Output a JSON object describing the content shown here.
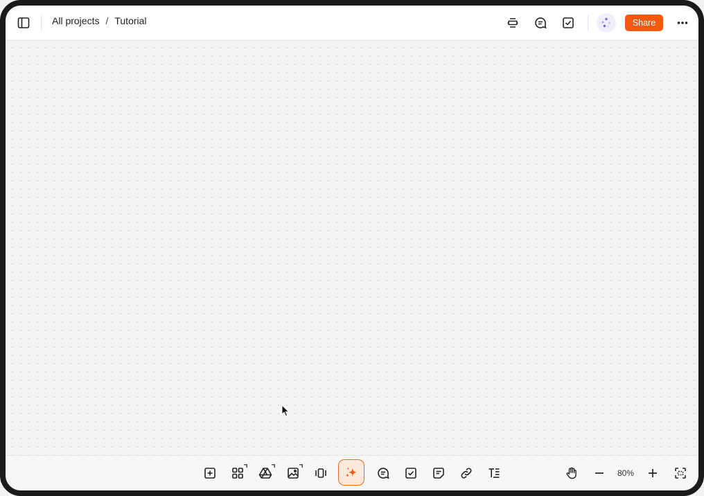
{
  "header": {
    "breadcrumb": {
      "root": "All projects",
      "separator": "/",
      "current": "Tutorial"
    },
    "share_label": "Share",
    "icons": [
      "sidebar-toggle-icon",
      "present-icon",
      "comment-icon",
      "task-check-icon",
      "ai-assistant-icon",
      "more-options-icon"
    ]
  },
  "toolbar": {
    "tools": [
      "add-block-icon",
      "apps-grid-icon",
      "google-drive-icon",
      "image-icon",
      "carousel-icon",
      "ai-sparkle-icon",
      "comment-icon",
      "task-check-icon",
      "note-icon",
      "link-icon",
      "text-format-icon"
    ],
    "zoom": {
      "level": "80%"
    },
    "right_icons": [
      "hand-pan-icon",
      "zoom-out-icon",
      "zoom-in-icon",
      "fit-to-screen-icon"
    ]
  },
  "colors": {
    "accent": "#f25a10",
    "ai_highlight_bg": "#fde8dc",
    "canvas_bg": "#f3f3f3",
    "frame": "#1b1b1b"
  }
}
